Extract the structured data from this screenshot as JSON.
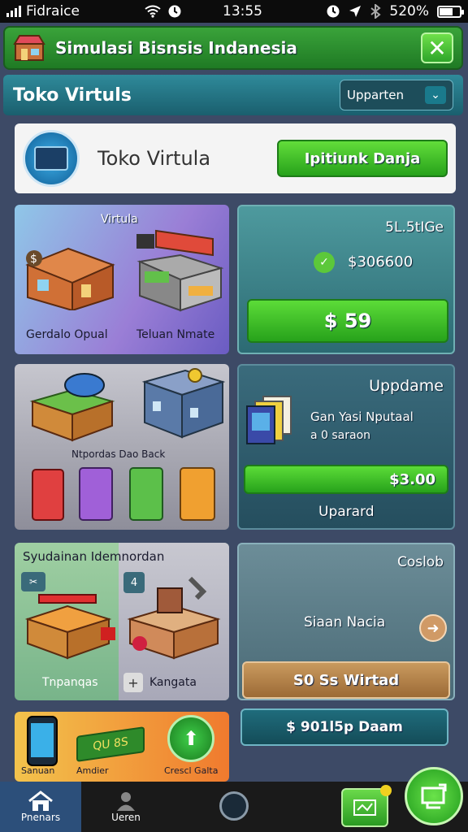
{
  "status": {
    "carrier": "Fidraice",
    "time": "13:55",
    "battery": "520%",
    "battery_level": 0.6
  },
  "app": {
    "title": "Simulasi Bisnsis Indanesia",
    "close_symbol": "✕"
  },
  "header": {
    "title": "Toko Virtuls",
    "dropdown_label": "Upparten",
    "dropdown_chevron": "⌄"
  },
  "store": {
    "name": "Toko Virtula",
    "claim_label": "Ipitiunk Danja"
  },
  "tiles": {
    "shop_title": "Virtula",
    "shop_left": "Gerdalo Opual",
    "shop_right": "Teluan Nmate",
    "goods_caption": "Ntpordas Dao Back",
    "stock_title": "Syudainan Idemnordan",
    "stock_left": "Tnpanqas",
    "stock_right": "Kangata",
    "bottom_left": "Sanuan",
    "bottom_mid": "Amdier",
    "bottom_right": "Crescl Galta",
    "bottom_mid_box": "QU 8S"
  },
  "panels": {
    "balance_title": "5L.5tIGe",
    "balance_value": "$306600",
    "balance_button": "$ 59",
    "upgrade_title": "Uppdame",
    "upgrade_desc_1": "Gan Yasi Nputaal",
    "upgrade_desc_2": "a 0 saraon",
    "upgrade_price": "$3.00",
    "upgrade_button": "Uparard",
    "close_title": "Coslob",
    "close_desc": "Siaan Nacia",
    "action_button": "S0 Ss Wirtad",
    "info_button": "$ 901l5p Daam"
  },
  "nav": {
    "home": "Pnenars",
    "user": "Ueren"
  },
  "colors": {
    "accent_green": "#2ea52a",
    "teal": "#1f6c7c",
    "background": "#3d4a66"
  }
}
